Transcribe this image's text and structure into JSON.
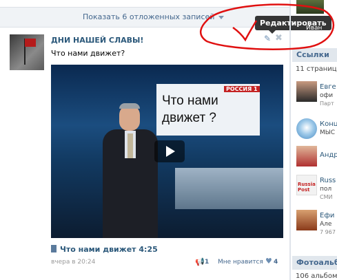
{
  "feed": {
    "show_postponed_label": "Показать 6 отложенных записей"
  },
  "post": {
    "group_name": "ДНИ НАШЕЙ СЛАВЫ!",
    "text": "Что нами движет?",
    "edit_tooltip": "Редактировать",
    "video": {
      "channel_logo": "РОССИЯ 1",
      "screen_caption": "Что нами движет ?",
      "title": "Что нами движет",
      "duration": "4:25"
    },
    "time": "вчера в 20:24",
    "share_count": "1",
    "like_label": "Мне нравится",
    "like_count": "4"
  },
  "sidebar": {
    "top_name": "Иван",
    "links_header": "Ссылки",
    "links_count": "11 страниц",
    "items": [
      {
        "t1": "Евге",
        "t2": "офи",
        "t3": "Парт"
      },
      {
        "t1": "Конц",
        "t2": "МЫС",
        "t3": ""
      },
      {
        "t1": "Андр",
        "t2": "",
        "t3": ""
      },
      {
        "t1": "Russ",
        "t2": "пол",
        "t3": "СМИ",
        "badge": "Russia Post"
      },
      {
        "t1": "Ефи",
        "t2": "Але",
        "t3": "7 967"
      }
    ],
    "albums_header": "Фотоальб",
    "albums_count": "106 альбомо"
  },
  "colors": {
    "link": "#2b587a",
    "accent": "#45688e",
    "annotation": "#e01010"
  }
}
